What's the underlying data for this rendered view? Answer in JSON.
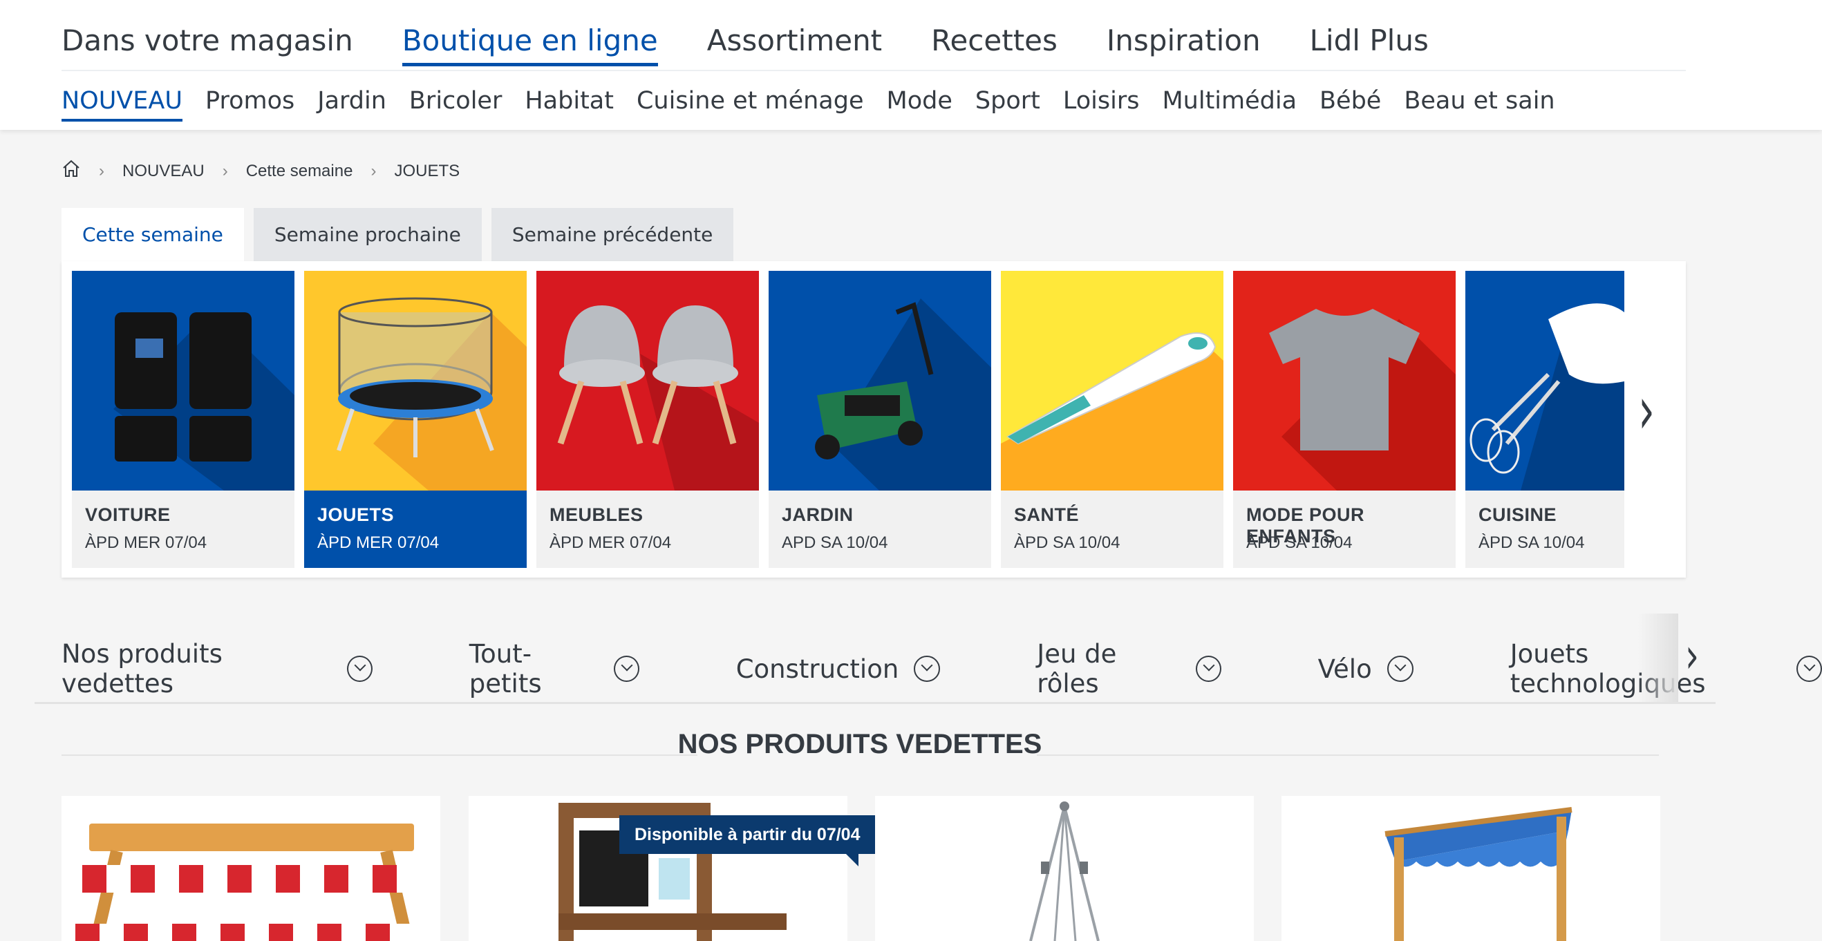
{
  "main_nav": [
    "Dans votre magasin",
    "Boutique en ligne",
    "Assortiment",
    "Recettes",
    "Inspiration",
    "Lidl Plus"
  ],
  "main_nav_active": "Boutique en ligne",
  "sub_nav": [
    "NOUVEAU",
    "Promos",
    "Jardin",
    "Bricoler",
    "Habitat",
    "Cuisine et ménage",
    "Mode",
    "Sport",
    "Loisirs",
    "Multimédia",
    "Bébé",
    "Beau et sain"
  ],
  "sub_nav_active": "NOUVEAU",
  "breadcrumb": [
    "NOUVEAU",
    "Cette semaine",
    "JOUETS"
  ],
  "week_tabs": [
    "Cette semaine",
    "Semaine prochaine",
    "Semaine précédente"
  ],
  "week_tab_active": "Cette semaine",
  "categories": [
    {
      "name": "VOITURE",
      "date": "ÀPD MER 07/04",
      "bg": "#0050aa"
    },
    {
      "name": "JOUETS",
      "date": "ÀPD MER 07/04",
      "bg": "#ffc72c",
      "selected": true
    },
    {
      "name": "MEUBLES",
      "date": "ÀPD MER 07/04",
      "bg": "#d71920"
    },
    {
      "name": "JARDIN",
      "date": "APD SA 10/04",
      "bg": "#0050aa"
    },
    {
      "name": "SANTÉ",
      "date": "ÀPD SA 10/04",
      "bg": "#ffe83a"
    },
    {
      "name": "MODE POUR ENFANTS",
      "date": "ÀPD SA 10/04",
      "bg": "#e2231a"
    },
    {
      "name": "CUISINE",
      "date": "ÀPD SA 10/04",
      "bg": "#0050aa"
    }
  ],
  "anchor_links": [
    "Nos produits vedettes",
    "Tout-petits",
    "Construction",
    "Jeu de rôles",
    "Vélo",
    "Jouets technologiques"
  ],
  "section_title": "NOS PRODUITS VEDETTES",
  "ribbon": "Disponible à partir du 07/04",
  "colors": {
    "accent": "#0050aa",
    "ribbon": "#0b3a6e",
    "text": "#353b42"
  }
}
